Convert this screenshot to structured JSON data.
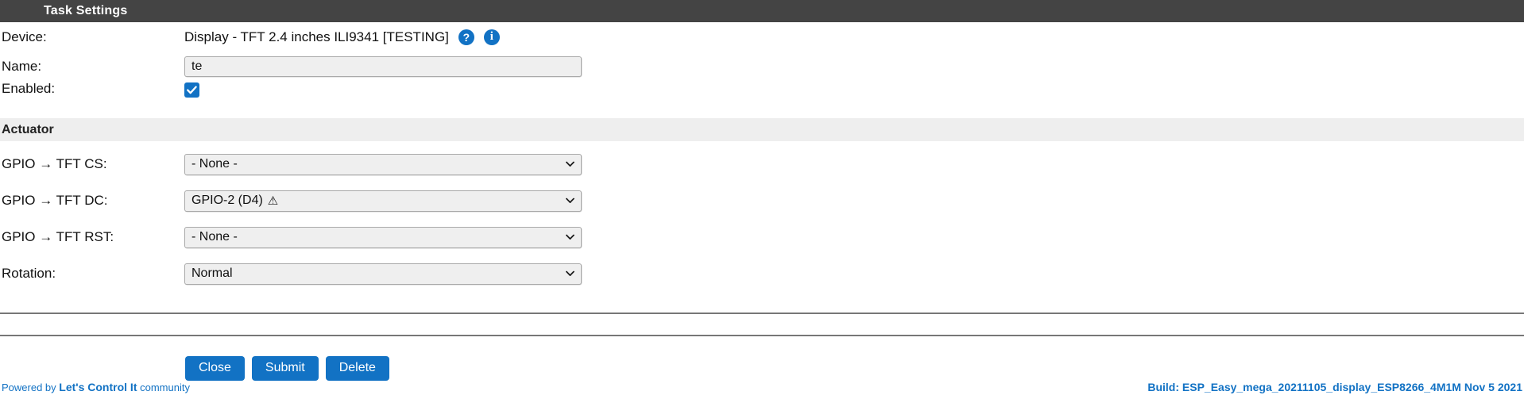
{
  "header": {
    "title": "Task Settings"
  },
  "form": {
    "device": {
      "label": "Device:",
      "value": "Display - TFT 2.4 inches ILI9341 [TESTING]",
      "help_badge": "?",
      "info_badge": "i"
    },
    "name": {
      "label": "Name:",
      "value": "te",
      "placeholder": ""
    },
    "enabled": {
      "label": "Enabled:",
      "checked": true
    }
  },
  "section": {
    "title": "Actuator",
    "fields": [
      {
        "label": "GPIO → TFT CS:",
        "value": "- None -",
        "warning": ""
      },
      {
        "label": "GPIO → TFT DC:",
        "value": "GPIO-2 (D4)",
        "warning": "⚠"
      },
      {
        "label": "GPIO → TFT RST:",
        "value": "- None -",
        "warning": ""
      },
      {
        "label": "Rotation:",
        "value": "Normal",
        "warning": ""
      }
    ]
  },
  "buttons": {
    "close": "Close",
    "submit": "Submit",
    "delete": "Delete"
  },
  "footer": {
    "powered_prefix": "Powered by ",
    "powered_strong": "Let's Control It",
    "powered_suffix": " community",
    "build": "Build: ESP_Easy_mega_20211105_display_ESP8266_4M1M Nov 5 2021"
  },
  "colors": {
    "accent": "#1272c4",
    "topbar": "#444444",
    "section_bg": "#eeeeee",
    "field_bg": "#efefef"
  }
}
